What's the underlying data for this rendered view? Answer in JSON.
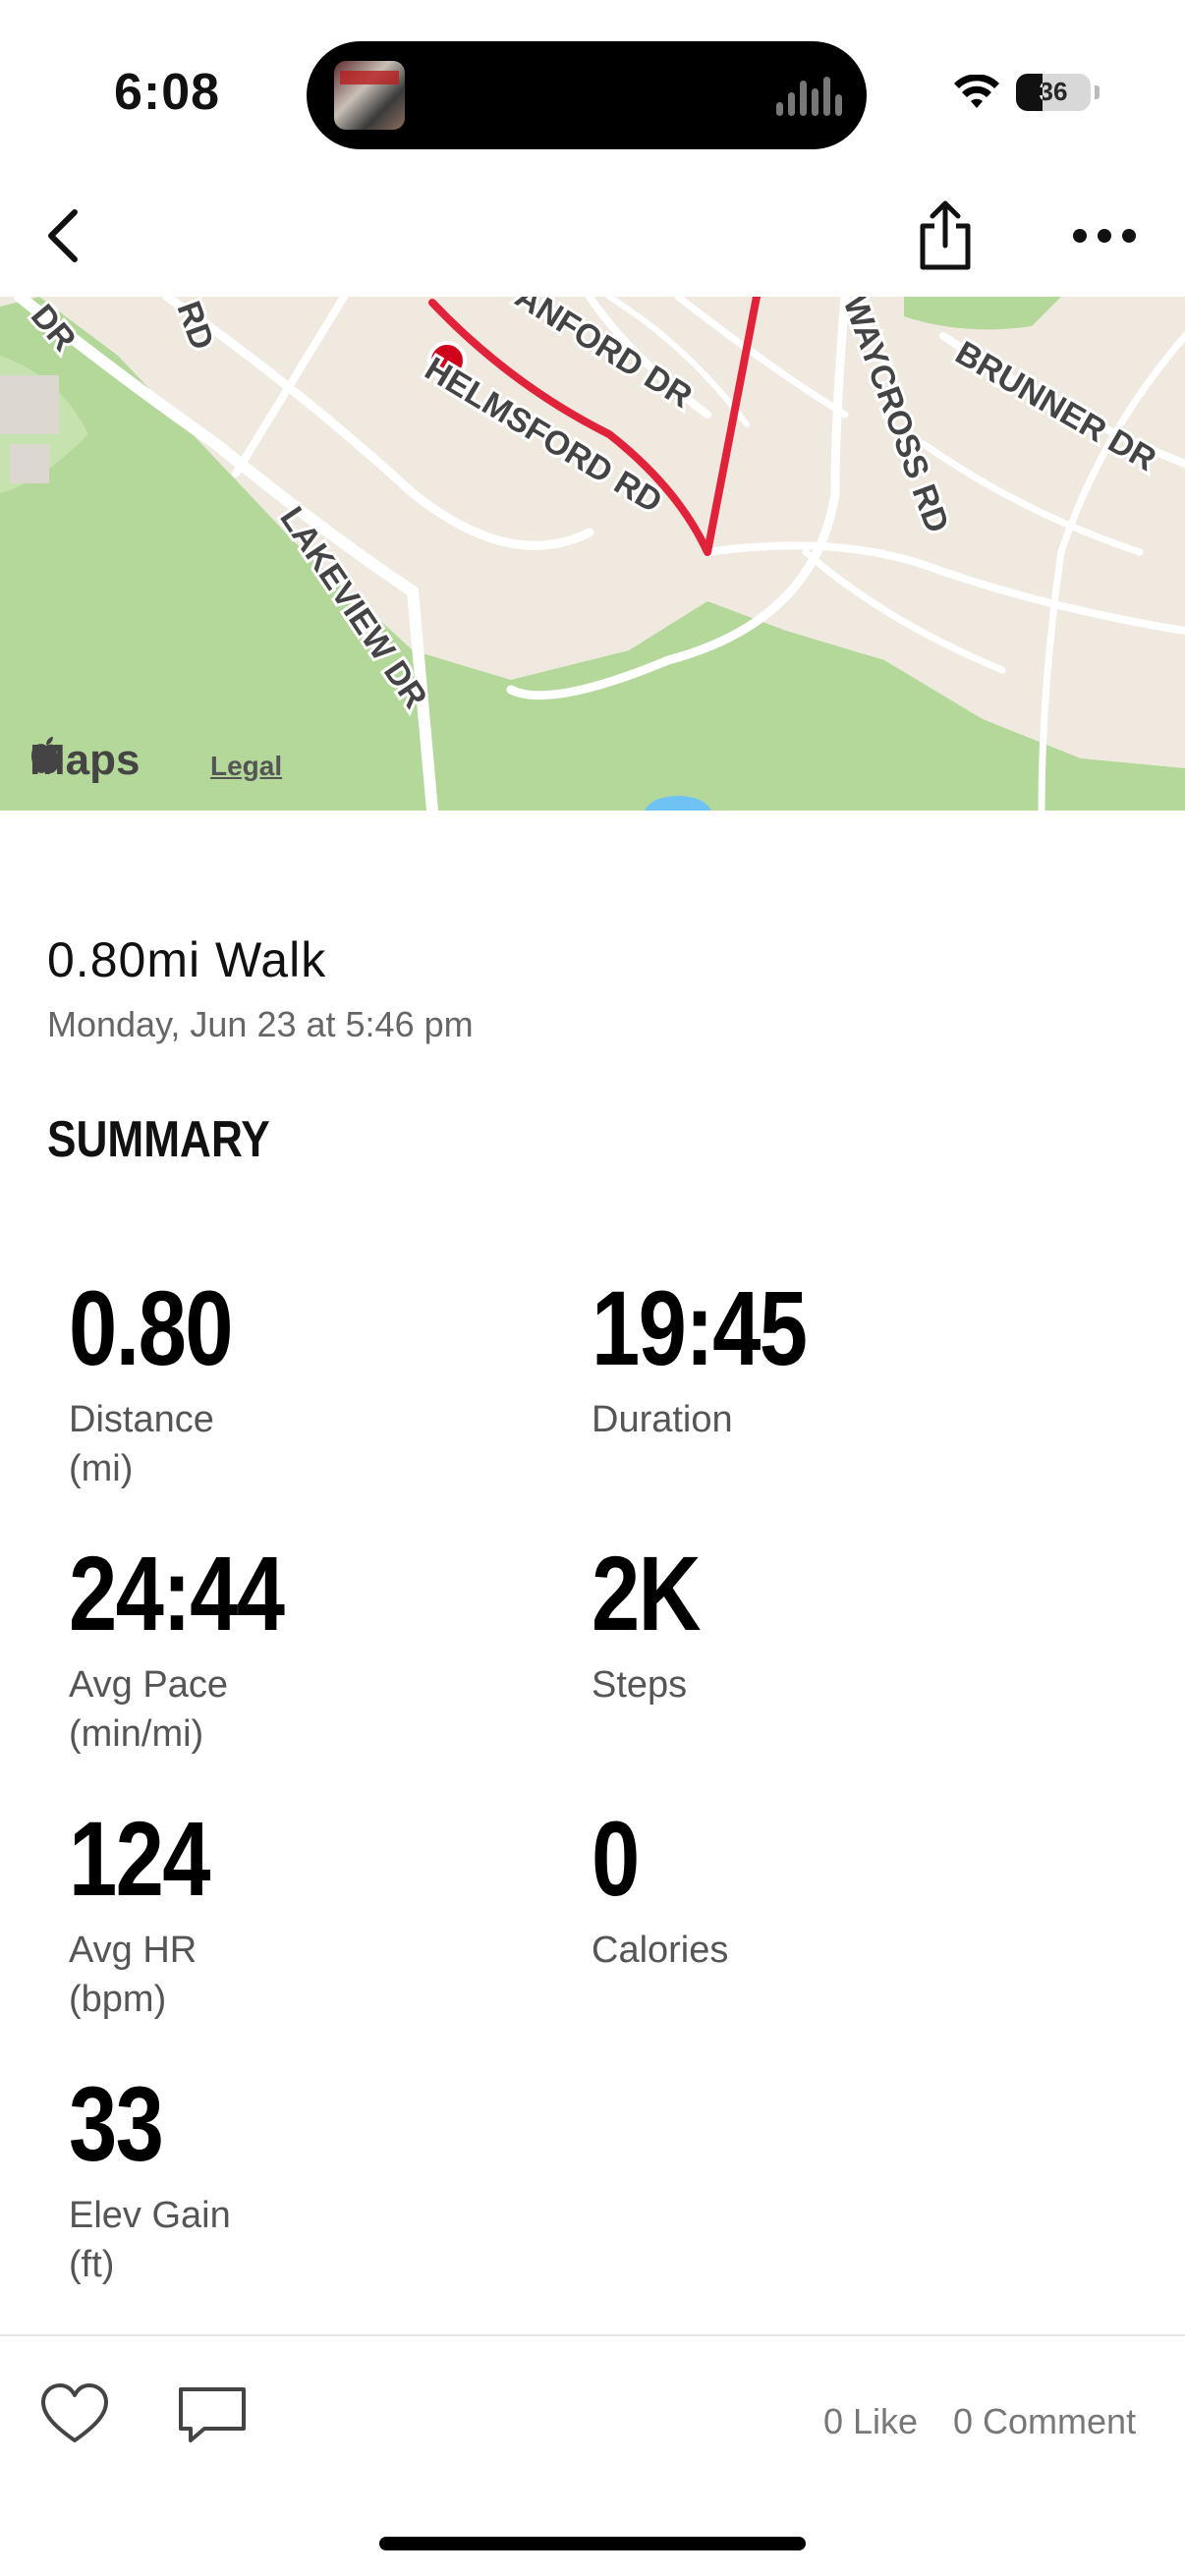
{
  "status_bar": {
    "time": "6:08",
    "battery_level": "36",
    "icons": [
      "now-playing-art",
      "audio-waveform-icon",
      "wifi-icon",
      "battery-icon"
    ]
  },
  "nav": {
    "icons": [
      "back-chevron-icon",
      "share-icon",
      "more-icon"
    ]
  },
  "map": {
    "road_labels": [
      "DR",
      "RD",
      "LAKEVIEW DR",
      "HELMSFORD RD",
      "ANFORD DR",
      "WAYCROSS RD",
      "BRUNNER DR"
    ],
    "logo_text": "Maps",
    "legal_text": "Legal",
    "route_color": "#e0223a",
    "start_marker_color": "#d0021b"
  },
  "workout": {
    "title": "0.80mi Walk",
    "date": "Monday, Jun 23 at 5:46 pm"
  },
  "summary": {
    "heading": "SUMMARY",
    "stats": [
      {
        "value": "0.80",
        "label": "Distance",
        "unit": "(mi)"
      },
      {
        "value": "19:45",
        "label": "Duration",
        "unit": ""
      },
      {
        "value": "24:44",
        "label": "Avg Pace",
        "unit": "(min/mi)"
      },
      {
        "value": "2K",
        "label": "Steps",
        "unit": ""
      },
      {
        "value": "124",
        "label": "Avg HR",
        "unit": "(bpm)"
      },
      {
        "value": "0",
        "label": "Calories",
        "unit": ""
      },
      {
        "value": "33",
        "label": "Elev Gain",
        "unit": "(ft)"
      }
    ]
  },
  "bottom_bar": {
    "likes": "0 Like",
    "comments": "0 Comment",
    "icons": [
      "heart-icon",
      "comment-icon"
    ]
  }
}
